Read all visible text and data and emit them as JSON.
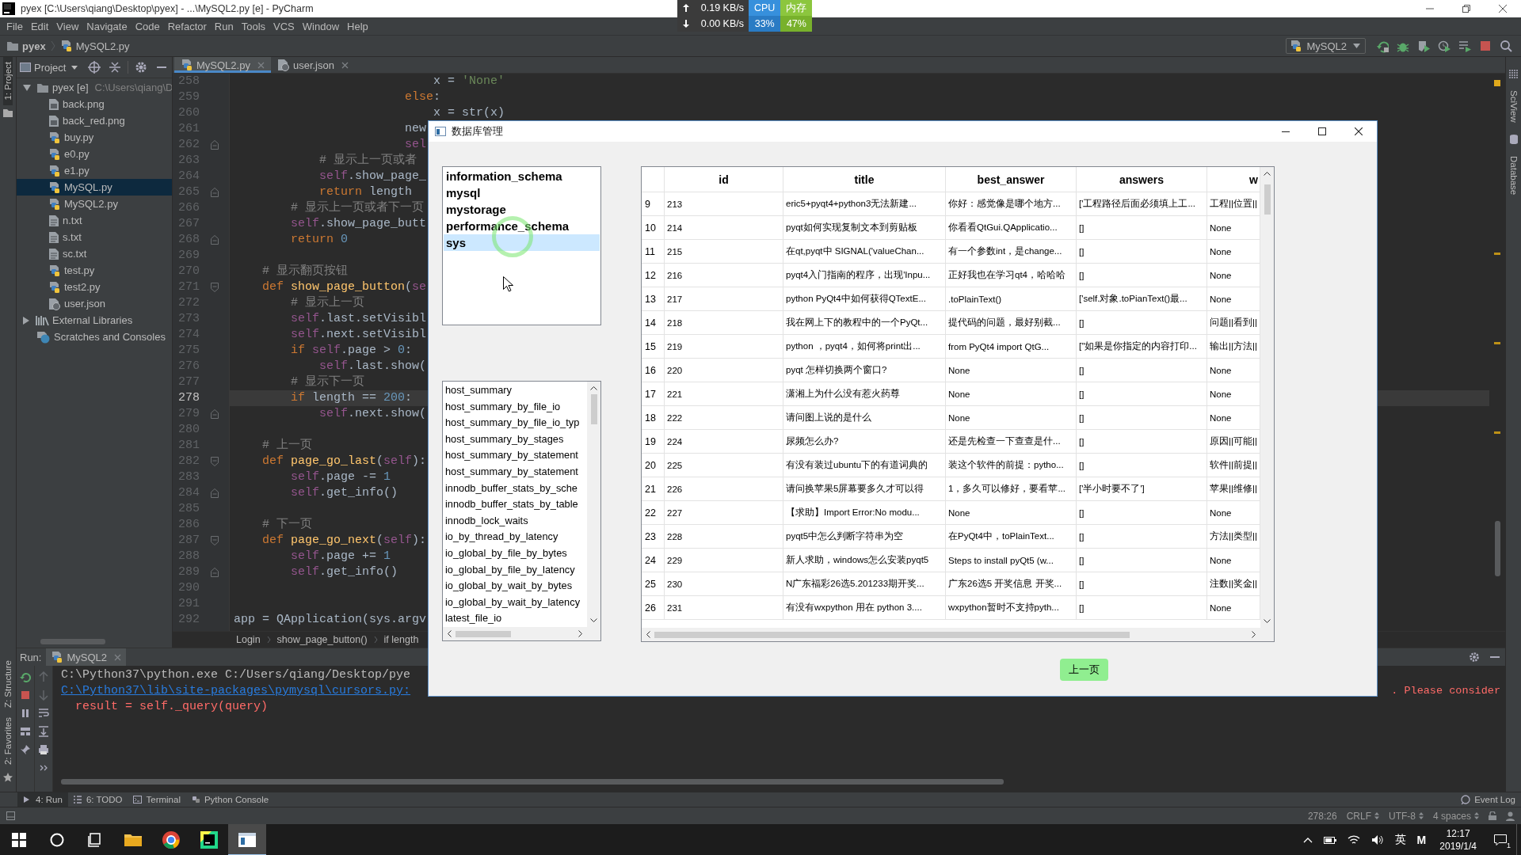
{
  "window": {
    "title": "pyex [C:\\Users\\qiang\\Desktop\\pyex] - ...\\MySQL2.py [e] - PyCharm"
  },
  "net_monitor": {
    "upload": "0.19 KB/s",
    "download": "0.00 KB/s",
    "cpu_label": "CPU",
    "cpu": "33%",
    "memory_label": "内存",
    "memory": "47%"
  },
  "menu": [
    "File",
    "Edit",
    "View",
    "Navigate",
    "Code",
    "Refactor",
    "Run",
    "Tools",
    "VCS",
    "Window",
    "Help"
  ],
  "navigation": {
    "crumbs": [
      {
        "label": "pyex",
        "kind": "folder"
      },
      {
        "label": "MySQL2.py",
        "kind": "python"
      }
    ],
    "run_config": "MySQL2"
  },
  "left_tool_strip": [
    "1: Project",
    "Z: Structure",
    "2: Favorites"
  ],
  "right_tool_strip": [
    "SciView",
    "Database"
  ],
  "project_panel": {
    "title": "Project",
    "tree": [
      {
        "label": "pyex [e]",
        "path": "C:\\Users\\qiang\\D",
        "kind": "folder",
        "expanded": true,
        "selected": false,
        "children": [
          {
            "label": "back.png",
            "kind": "image",
            "selected": false
          },
          {
            "label": "back_red.png",
            "kind": "image",
            "selected": false
          },
          {
            "label": "buy.py",
            "kind": "python",
            "selected": false
          },
          {
            "label": "e0.py",
            "kind": "python",
            "selected": false
          },
          {
            "label": "e1.py",
            "kind": "python",
            "selected": false
          },
          {
            "label": "MySQL.py",
            "kind": "python",
            "selected": true
          },
          {
            "label": "MySQL2.py",
            "kind": "python",
            "selected": false
          },
          {
            "label": "n.txt",
            "kind": "text",
            "selected": false
          },
          {
            "label": "s.txt",
            "kind": "text",
            "selected": false
          },
          {
            "label": "sc.txt",
            "kind": "text",
            "selected": false
          },
          {
            "label": "test.py",
            "kind": "python",
            "selected": false
          },
          {
            "label": "test2.py",
            "kind": "python",
            "selected": false
          },
          {
            "label": "user.json",
            "kind": "json",
            "selected": false
          }
        ]
      },
      {
        "label": "External Libraries",
        "kind": "library",
        "expanded": false,
        "selected": false
      },
      {
        "label": "Scratches and Consoles",
        "kind": "scratches",
        "selected": false
      }
    ]
  },
  "editor": {
    "tabs": [
      {
        "label": "MySQL2.py",
        "kind": "python",
        "selected": true
      },
      {
        "label": "user.json",
        "kind": "json",
        "selected": false
      }
    ],
    "lines": [
      {
        "number": "258",
        "kind": "code",
        "current": false,
        "segments": [
          {
            "kind": "plain",
            "text": "                            x = "
          },
          {
            "kind": "string",
            "text": "'None'"
          }
        ]
      },
      {
        "number": "259",
        "kind": "code",
        "current": false,
        "segments": [
          {
            "kind": "keyword",
            "text": "                        else"
          },
          {
            "kind": "plain",
            "text": ":"
          }
        ]
      },
      {
        "number": "260",
        "kind": "code",
        "current": false,
        "segments": [
          {
            "kind": "plain",
            "text": "                            x = str(x)"
          }
        ]
      },
      {
        "number": "261",
        "kind": "code",
        "current": false,
        "segments": [
          {
            "kind": "plain",
            "text": "                        new"
          }
        ]
      },
      {
        "number": "262",
        "kind": "fold_end",
        "current": false,
        "segments": [
          {
            "kind": "self",
            "text": "                        sel"
          }
        ]
      },
      {
        "number": "263",
        "kind": "code",
        "current": false,
        "segments": [
          {
            "kind": "comment",
            "text": "            # 显示上一页或者"
          }
        ]
      },
      {
        "number": "264",
        "kind": "code",
        "current": false,
        "segments": [
          {
            "kind": "self",
            "text": "            self"
          },
          {
            "kind": "plain",
            "text": ".show_page_"
          }
        ]
      },
      {
        "number": "265",
        "kind": "fold_end",
        "current": false,
        "segments": [
          {
            "kind": "keyword",
            "text": "            return"
          },
          {
            "kind": "plain",
            "text": " length"
          }
        ]
      },
      {
        "number": "266",
        "kind": "code",
        "current": false,
        "segments": [
          {
            "kind": "comment",
            "text": "        # 显示上一页或者下一页"
          }
        ]
      },
      {
        "number": "267",
        "kind": "code",
        "current": false,
        "segments": [
          {
            "kind": "self",
            "text": "        self"
          },
          {
            "kind": "plain",
            "text": ".show_page_butt"
          }
        ]
      },
      {
        "number": "268",
        "kind": "fold_end",
        "current": false,
        "segments": [
          {
            "kind": "keyword",
            "text": "        return "
          },
          {
            "kind": "number",
            "text": "0"
          }
        ]
      },
      {
        "number": "269",
        "kind": "code",
        "current": false
      },
      {
        "number": "270",
        "kind": "code",
        "current": false,
        "segments": [
          {
            "kind": "comment",
            "text": "    # 显示翻页按钮"
          }
        ]
      },
      {
        "number": "271",
        "kind": "fold_start",
        "current": false,
        "segments": [
          {
            "kind": "keyword",
            "text": "    def "
          },
          {
            "kind": "function",
            "text": "show_page_button"
          },
          {
            "kind": "plain",
            "text": "("
          },
          {
            "kind": "self",
            "text": "se"
          }
        ]
      },
      {
        "number": "272",
        "kind": "code",
        "current": false,
        "segments": [
          {
            "kind": "comment",
            "text": "        # 显示上一页"
          }
        ]
      },
      {
        "number": "273",
        "kind": "code",
        "current": false,
        "segments": [
          {
            "kind": "self",
            "text": "        self"
          },
          {
            "kind": "plain",
            "text": ".last.setVisibl"
          }
        ]
      },
      {
        "number": "274",
        "kind": "code",
        "current": false,
        "segments": [
          {
            "kind": "self",
            "text": "        self"
          },
          {
            "kind": "plain",
            "text": ".next.setVisibl"
          }
        ]
      },
      {
        "number": "275",
        "kind": "code",
        "current": false,
        "segments": [
          {
            "kind": "keyword",
            "text": "        if "
          },
          {
            "kind": "self",
            "text": "self"
          },
          {
            "kind": "plain",
            "text": ".page > "
          },
          {
            "kind": "number",
            "text": "0"
          },
          {
            "kind": "plain",
            "text": ":"
          }
        ]
      },
      {
        "number": "276",
        "kind": "code",
        "current": false,
        "segments": [
          {
            "kind": "self",
            "text": "            self"
          },
          {
            "kind": "plain",
            "text": ".last.show("
          }
        ]
      },
      {
        "number": "277",
        "kind": "code",
        "current": false,
        "segments": [
          {
            "kind": "comment",
            "text": "        # 显示下一页"
          }
        ]
      },
      {
        "number": "278",
        "kind": "code",
        "current": true,
        "segments": [
          {
            "kind": "keyword",
            "text": "        if "
          },
          {
            "kind": "plain",
            "text": "length == "
          },
          {
            "kind": "number",
            "text": "200"
          },
          {
            "kind": "plain",
            "text": ":"
          }
        ]
      },
      {
        "number": "279",
        "kind": "fold_end",
        "current": false,
        "segments": [
          {
            "kind": "self",
            "text": "            self"
          },
          {
            "kind": "plain",
            "text": ".next.show("
          }
        ]
      },
      {
        "number": "280",
        "kind": "code",
        "current": false
      },
      {
        "number": "281",
        "kind": "code",
        "current": false,
        "segments": [
          {
            "kind": "comment",
            "text": "    # 上一页"
          }
        ]
      },
      {
        "number": "282",
        "kind": "fold_start",
        "current": false,
        "segments": [
          {
            "kind": "keyword",
            "text": "    def "
          },
          {
            "kind": "function",
            "text": "page_go_last"
          },
          {
            "kind": "plain",
            "text": "("
          },
          {
            "kind": "self",
            "text": "self"
          },
          {
            "kind": "plain",
            "text": "):"
          }
        ]
      },
      {
        "number": "283",
        "kind": "code",
        "current": false,
        "segments": [
          {
            "kind": "self",
            "text": "        self"
          },
          {
            "kind": "plain",
            "text": ".page -= "
          },
          {
            "kind": "number",
            "text": "1"
          }
        ]
      },
      {
        "number": "284",
        "kind": "fold_end",
        "current": false,
        "segments": [
          {
            "kind": "self",
            "text": "        self"
          },
          {
            "kind": "plain",
            "text": ".get_info()"
          }
        ]
      },
      {
        "number": "285",
        "kind": "code",
        "current": false
      },
      {
        "number": "286",
        "kind": "code",
        "current": false,
        "segments": [
          {
            "kind": "comment",
            "text": "    # 下一页"
          }
        ]
      },
      {
        "number": "287",
        "kind": "fold_start",
        "current": false,
        "segments": [
          {
            "kind": "keyword",
            "text": "    def "
          },
          {
            "kind": "function",
            "text": "page_go_next"
          },
          {
            "kind": "plain",
            "text": "("
          },
          {
            "kind": "self",
            "text": "self"
          },
          {
            "kind": "plain",
            "text": "):"
          }
        ]
      },
      {
        "number": "288",
        "kind": "code",
        "current": false,
        "segments": [
          {
            "kind": "self",
            "text": "        self"
          },
          {
            "kind": "plain",
            "text": ".page += "
          },
          {
            "kind": "number",
            "text": "1"
          }
        ]
      },
      {
        "number": "289",
        "kind": "fold_end",
        "current": false,
        "segments": [
          {
            "kind": "self",
            "text": "        self"
          },
          {
            "kind": "plain",
            "text": ".get_info()"
          }
        ]
      },
      {
        "number": "290",
        "kind": "code",
        "current": false
      },
      {
        "number": "291",
        "kind": "code",
        "current": false
      },
      {
        "number": "292",
        "kind": "code",
        "current": false,
        "segments": [
          {
            "kind": "plain",
            "text": "app = QApplication(sys.argv"
          }
        ]
      }
    ],
    "breadcrumbs": [
      "Login",
      "show_page_button()",
      "if length"
    ]
  },
  "run_panel": {
    "label": "Run:",
    "tabs": [
      {
        "label": "MySQL2",
        "selected": true
      }
    ],
    "lines": [
      {
        "kind": "plain",
        "text": "C:\\Python37\\python.exe C:/Users/qiang/Desktop/pye"
      },
      {
        "kind": "link",
        "text": "C:\\Python37\\lib\\site-packages\\pymysql\\cursors.py:",
        "tail": ". Please consider"
      },
      {
        "kind": "error",
        "text": "  result = self._query(query)"
      }
    ]
  },
  "bottom_tabs": [
    {
      "label": "4: Run",
      "selected": true
    },
    {
      "label": "6: TODO",
      "selected": false
    },
    {
      "label": "Terminal",
      "selected": false
    },
    {
      "label": "Python Console",
      "selected": false
    }
  ],
  "event_log": "Event Log",
  "status_bar": {
    "position": "278:26",
    "line_separator": "CRLF",
    "encoding": "UTF-8",
    "indent": "4 spaces"
  },
  "taskbar": {
    "apps": [
      {
        "kind": "explorer",
        "selected": false
      },
      {
        "kind": "chrome",
        "selected": false
      },
      {
        "kind": "pycharm",
        "selected": false
      },
      {
        "kind": "window",
        "selected": true
      }
    ],
    "ime_language": "英",
    "ime_mode": "M",
    "time": "12:17",
    "date": "2019/1/4",
    "notification_count": "1"
  },
  "dialog": {
    "title": "数据库管理",
    "databases": [
      {
        "name": "information_schema",
        "selected": false
      },
      {
        "name": "mysql",
        "selected": false
      },
      {
        "name": "mystorage",
        "selected": false
      },
      {
        "name": "performance_schema",
        "selected": false
      },
      {
        "name": "sys",
        "selected": true
      }
    ],
    "tables": [
      "host_summary",
      "host_summary_by_file_io",
      "host_summary_by_file_io_typ",
      "host_summary_by_stages",
      "host_summary_by_statement",
      "host_summary_by_statement",
      "innodb_buffer_stats_by_sche",
      "innodb_buffer_stats_by_table",
      "innodb_lock_waits",
      "io_by_thread_by_latency",
      "io_global_by_file_by_bytes",
      "io_global_by_file_by_latency",
      "io_global_by_wait_by_bytes",
      "io_global_by_wait_by_latency",
      "latest_file_io"
    ],
    "table": {
      "columns": [
        "id",
        "title",
        "best_answer",
        "answers",
        "w"
      ],
      "rows": [
        {
          "index": "9",
          "cells": [
            "213",
            "eric5+pyqt4+python3无法新建...",
            "你好：感觉像是哪个地方...",
            "['工程路径后面必须填上工...",
            "工程||位置||"
          ]
        },
        {
          "index": "10",
          "cells": [
            "214",
            "pyqt如何实现复制文本到剪贴板",
            "你看看QtGui.QApplicatio...",
            "[]",
            "None"
          ]
        },
        {
          "index": "11",
          "cells": [
            "215",
            "在qt,pyqt中 SIGNAL('valueChan...",
            "有一个参数int，是change...",
            "[]",
            "None"
          ]
        },
        {
          "index": "12",
          "cells": [
            "216",
            "pyqt4入门指南的程序，出现'Inpu...",
            "正好我也在学习qt4，哈哈哈",
            "[]",
            "None"
          ]
        },
        {
          "index": "13",
          "cells": [
            "217",
            "python PyQt4中如何获得QTextE...",
            ".toPlainText()",
            "['self.对象.toPianText()最...",
            "None"
          ]
        },
        {
          "index": "14",
          "cells": [
            "218",
            "我在网上下的教程中的一个PyQt...",
            "提代码的问题，最好别截...",
            "[]",
            "问题||看到||"
          ]
        },
        {
          "index": "15",
          "cells": [
            "219",
            "python ，pyqt4，如何将print出...",
            "from PyQt4 import QtG...",
            "[\"如果是你指定的内容打印...",
            "输出||方法||"
          ]
        },
        {
          "index": "16",
          "cells": [
            "220",
            "pyqt 怎样切换两个窗口?",
            "None",
            "[]",
            "None"
          ]
        },
        {
          "index": "17",
          "cells": [
            "221",
            "潇湘上为什么没有惹火药尊",
            "None",
            "[]",
            "None"
          ]
        },
        {
          "index": "18",
          "cells": [
            "222",
            "请问图上说的是什么",
            "None",
            "[]",
            "None"
          ]
        },
        {
          "index": "19",
          "cells": [
            "224",
            "尿频怎么办?",
            "还是先检查一下查查是什...",
            "[]",
            "原因||可能||"
          ]
        },
        {
          "index": "20",
          "cells": [
            "225",
            "有没有装过ubuntu下的有道词典的",
            "装这个软件的前提：pytho...",
            "[]",
            "软件||前提||"
          ]
        },
        {
          "index": "21",
          "cells": [
            "226",
            "请问换苹果5屏幕要多久才可以得",
            "1，多久可以修好，要看苹...",
            "['半小时要不了']",
            "苹果||维修||"
          ]
        },
        {
          "index": "22",
          "cells": [
            "227",
            "【求助】Import Error:No modu...",
            "None",
            "[]",
            "None"
          ]
        },
        {
          "index": "23",
          "cells": [
            "228",
            "pyqt5中怎么判断字符串为空",
            "在PyQt4中，toPlainText...",
            "[]",
            "方法||类型||"
          ]
        },
        {
          "index": "24",
          "cells": [
            "229",
            "新人求助，windows怎么安装pyqt5",
            "Steps to install pyQt5 (w...",
            "[]",
            "None"
          ]
        },
        {
          "index": "25",
          "cells": [
            "230",
            "N广东福彩26选5.201233期开奖...",
            "广东26选5 开奖信息 开奖...",
            "[]",
            "注数||奖金||"
          ]
        },
        {
          "index": "26",
          "cells": [
            "231",
            "有没有wxpython 用在 python 3....",
            "wxpython暂时不支持pyth...",
            "[]",
            "None"
          ]
        }
      ]
    },
    "buttons": [
      {
        "label": "上一页"
      }
    ]
  }
}
